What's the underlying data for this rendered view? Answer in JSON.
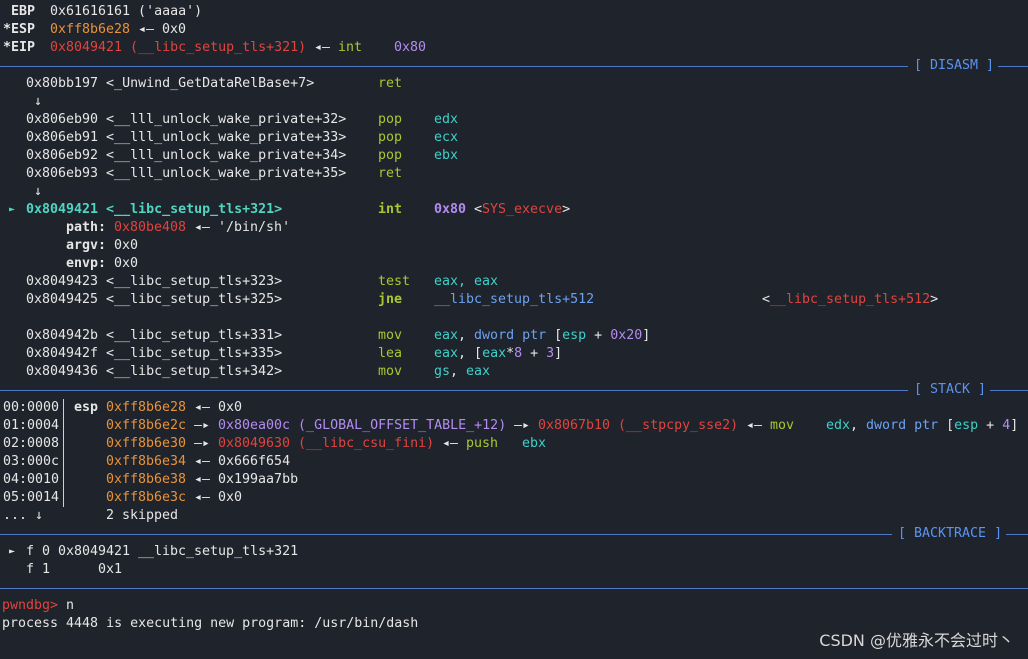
{
  "registers": [
    {
      "mark": " ",
      "name": "EBP",
      "value": "0x61616161 ('aaaa')"
    },
    {
      "mark": "*",
      "name": "ESP",
      "addr": "0xff8b6e28",
      "arrow": " ◂— ",
      "val": "0x0"
    },
    {
      "mark": "*",
      "name": "EIP",
      "addr": "0x8049421 (__libc_setup_tls+321)",
      "arrow": " ◂— ",
      "instr": "int",
      "op": "0x80"
    }
  ],
  "sections": {
    "disasm": "[ DISASM ]",
    "stack": "[ STACK ]",
    "backtrace": "[ BACKTRACE ]"
  },
  "disasm": [
    {
      "addr": "0x80bb197 <_Unwind_GetDataRelBase+7>",
      "mn": "ret",
      "ops": ""
    },
    {
      "arrow": "↓"
    },
    {
      "addr": "0x806eb90 <__lll_unlock_wake_private+32>",
      "mn": "pop",
      "ops": "edx"
    },
    {
      "addr": "0x806eb91 <__lll_unlock_wake_private+33>",
      "mn": "pop",
      "ops": "ecx"
    },
    {
      "addr": "0x806eb92 <__lll_unlock_wake_private+34>",
      "mn": "pop",
      "ops": "ebx"
    },
    {
      "addr": "0x806eb93 <__lll_unlock_wake_private+35>",
      "mn": "ret",
      "ops": ""
    },
    {
      "arrow": "↓"
    },
    {
      "cur": "►",
      "addr": "0x8049421 <__libc_setup_tls+321>",
      "mn": "int",
      "ops": "0x80",
      "extra": "<SYS_execve>"
    },
    {
      "arg": "path:",
      "argval": "0x80be408",
      "argrest": " ◂— '/bin/sh'"
    },
    {
      "arg": "argv:",
      "argrest": " 0x0"
    },
    {
      "arg": "envp:",
      "argrest": " 0x0"
    },
    {
      "addr": "0x8049423 <__libc_setup_tls+323>",
      "mn": "test",
      "ops": "eax, eax"
    },
    {
      "addr": "0x8049425 <__libc_setup_tls+325>",
      "mn": "jne",
      "ops": "__libc_setup_tls+512",
      "extra": "<__libc_setup_tls+512>"
    },
    {
      "addr": "0x804942b <__libc_setup_tls+331>",
      "mn": "mov",
      "ops": "eax, dword ptr [esp + 0x20]"
    },
    {
      "addr": "0x804942f <__libc_setup_tls+335>",
      "mn": "lea",
      "ops": "eax, [eax*8 + 3]"
    },
    {
      "addr": "0x8049436 <__libc_setup_tls+342>",
      "mn": "mov",
      "ops": "gs, eax"
    }
  ],
  "stack": [
    {
      "idx": "00:0000",
      "reg": "esp",
      "addr": "0xff8b6e28",
      "rest": " ◂— 0x0"
    },
    {
      "idx": "01:0004",
      "addr": "0xff8b6e2c",
      "p1": "0x80ea00c (_GLOBAL_OFFSET_TABLE_+12)",
      "p2": "0x8067b10 (__stpcpy_sse2)",
      "instr": "mov",
      "ops": "edx, dword ptr [esp + 4]"
    },
    {
      "idx": "02:0008",
      "addr": "0xff8b6e30",
      "p1": "0x8049630 (__libc_csu_fini)",
      "instr": "push",
      "ops": "ebx"
    },
    {
      "idx": "03:000c",
      "addr": "0xff8b6e34",
      "rest": " ◂— 0x666f654"
    },
    {
      "idx": "04:0010",
      "addr": "0xff8b6e38",
      "rest": " ◂— 0x199aa7bb"
    },
    {
      "idx": "05:0014",
      "addr": "0xff8b6e3c",
      "rest": " ◂— 0x0"
    },
    {
      "idx": "... ↓",
      "skipped": "2 skipped"
    }
  ],
  "backtrace": [
    {
      "cur": "►",
      "frame": "f 0",
      "addr": "0x8049421",
      "sym": "__libc_setup_tls+321"
    },
    {
      "cur": "",
      "frame": "f 1",
      "addr": "0x1",
      "sym": ""
    }
  ],
  "console": {
    "prompt": "pwndbg>",
    "command": "n",
    "output": "process 4448 is executing new program: /usr/bin/dash"
  },
  "watermark": "CSDN @优雅永不会过时丶",
  "colors": {
    "bg": "#1f232b",
    "addr_stack": "#e8933a",
    "addr_code": "#e0443e",
    "mnemonic": "#a9c72f",
    "register": "#3fd0c8",
    "number": "#b48cf0",
    "section": "#5b93f0"
  }
}
